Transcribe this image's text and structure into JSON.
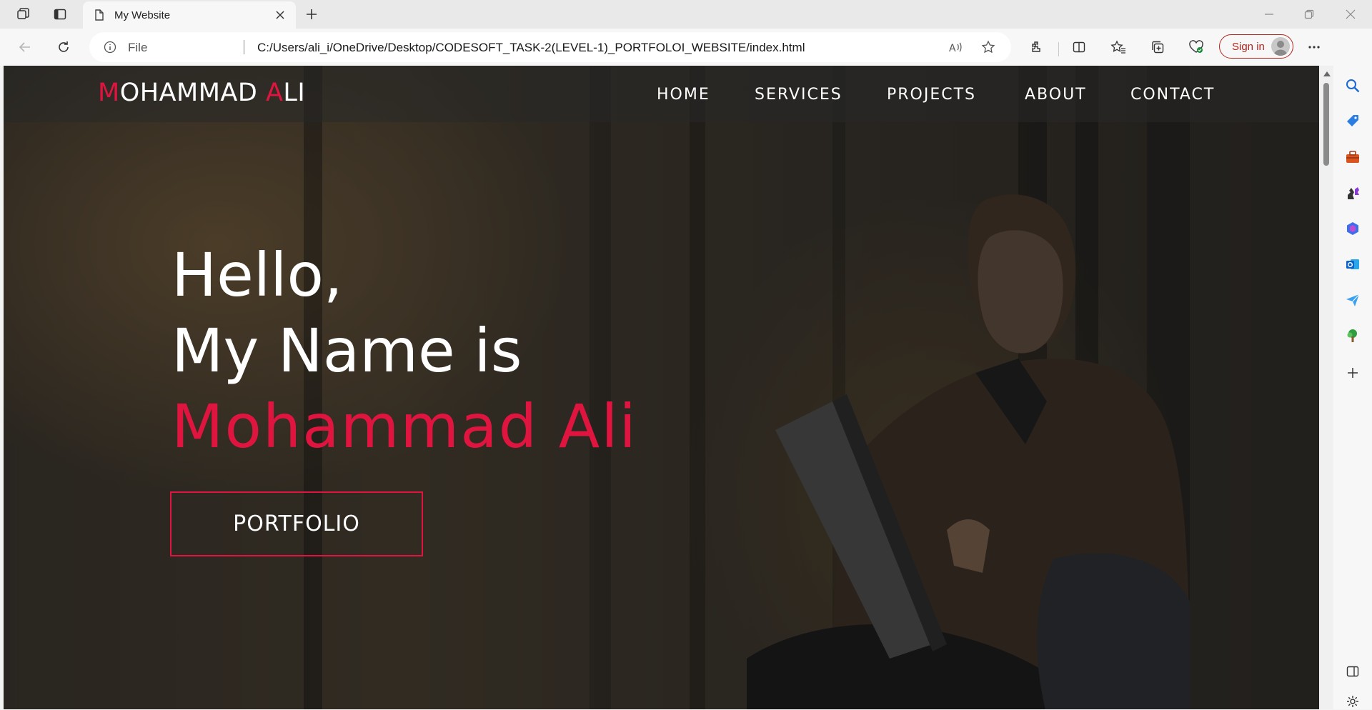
{
  "browser": {
    "tab_title": "My Website",
    "address": {
      "scheme_label": "File",
      "url": "C:/Users/ali_i/OneDrive/Desktop/CODESOFT_TASK-2(LEVEL-1)_PORTFOLOI_WEBSITE/index.html"
    },
    "signin_label": "Sign in",
    "colors": {
      "signin": "#b3261e"
    }
  },
  "site": {
    "logo": {
      "first_initial": "M",
      "first_rest": "OHAMMAD ",
      "last_initial": "A",
      "last_rest": "LI"
    },
    "nav": [
      "HOME",
      "SERVICES",
      "PROJECTS",
      "ABOUT",
      "CONTACT"
    ],
    "hero": {
      "line1": "Hello,",
      "line2": "My Name is",
      "name": "Mohammad Ali",
      "button": "PORTFOLIO"
    },
    "colors": {
      "accent": "#e0153f",
      "text": "#ffffff"
    }
  },
  "icons": {
    "tabstrip": [
      "workspaces-icon",
      "vertical-tabs-icon",
      "page-icon",
      "close-icon",
      "plus-icon",
      "minimize-icon",
      "restore-icon",
      "close-window-icon"
    ],
    "toolbar": [
      "back-arrow-icon",
      "refresh-icon",
      "info-icon",
      "read-aloud-icon",
      "favorite-star-icon",
      "extensions-icon",
      "split-screen-icon",
      "favorites-icon",
      "collections-icon",
      "browser-essentials-icon",
      "more-icon",
      "copilot-icon"
    ],
    "sidebar": [
      "search-icon",
      "shopping-tag-icon",
      "tools-icon",
      "games-icon",
      "microsoft365-icon",
      "outlook-icon",
      "send-icon",
      "tree-icon",
      "add-icon",
      "sidebar-toggle-icon",
      "settings-icon"
    ]
  }
}
